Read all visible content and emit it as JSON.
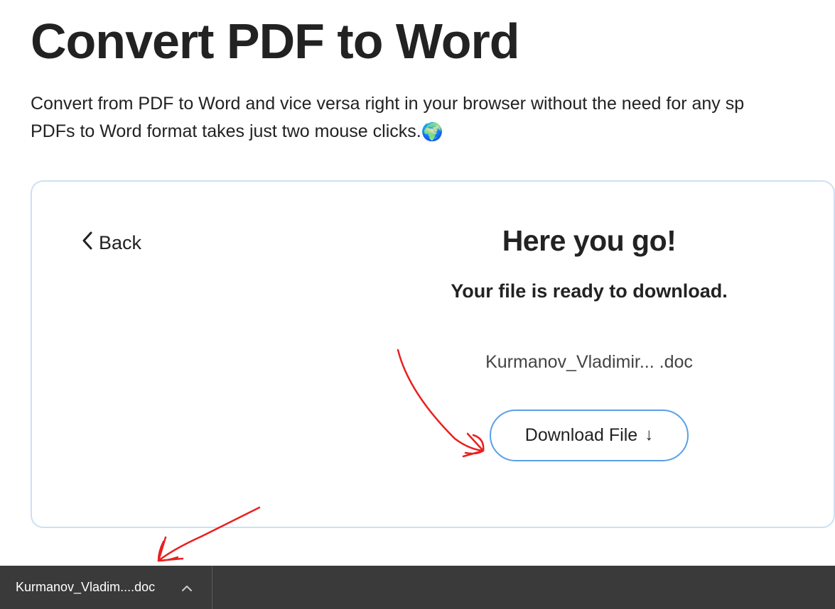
{
  "page": {
    "title": "Convert PDF to Word",
    "description_line1": "Convert from PDF to Word and vice versa right in your browser without the need for any sp",
    "description_line2": "PDFs to Word format takes just two mouse clicks.",
    "globe_emoji": "🌍"
  },
  "card": {
    "back_label": "Back",
    "result_title": "Here you go!",
    "result_subtitle": "Your file is ready to download.",
    "file_name": "Kurmanov_Vladimir...  .doc",
    "download_label": "Download File",
    "download_arrow_glyph": "↓"
  },
  "downloads_bar": {
    "item_label": "Kurmanov_Vladim....doc"
  }
}
